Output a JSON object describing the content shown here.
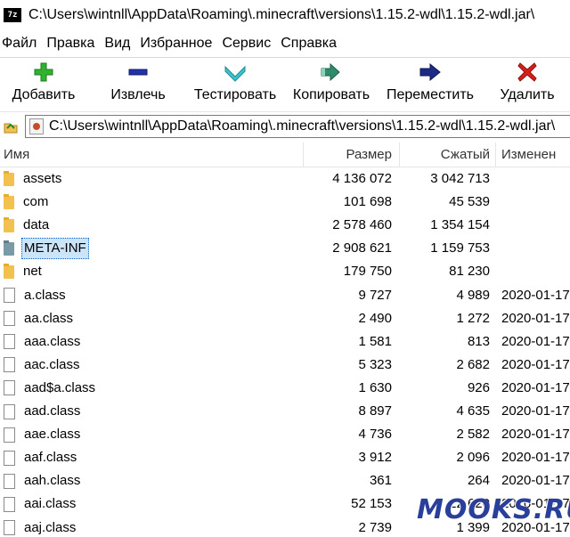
{
  "window": {
    "app_icon_text": "7z",
    "title": "C:\\Users\\wintnll\\AppData\\Roaming\\.minecraft\\versions\\1.15.2-wdl\\1.15.2-wdl.jar\\"
  },
  "menu": [
    "Файл",
    "Правка",
    "Вид",
    "Избранное",
    "Сервис",
    "Справка"
  ],
  "toolbar": {
    "add": {
      "label": "Добавить",
      "icon": "plus-icon",
      "color": "#2fb32f"
    },
    "extract": {
      "label": "Извлечь",
      "icon": "minus-icon",
      "color": "#2231a8"
    },
    "test": {
      "label": "Тестировать",
      "icon": "check-icon",
      "color": "#3bc6cf"
    },
    "copy": {
      "label": "Копировать",
      "icon": "double-arrow-icon",
      "color": "#2e8b6b"
    },
    "move": {
      "label": "Переместить",
      "icon": "arrow-right-icon",
      "color": "#1c2c86"
    },
    "delete": {
      "label": "Удалить",
      "icon": "x-icon",
      "color": "#d6201a"
    }
  },
  "address": {
    "path": "C:\\Users\\wintnll\\AppData\\Roaming\\.minecraft\\versions\\1.15.2-wdl\\1.15.2-wdl.jar\\"
  },
  "columns": {
    "name": "Имя",
    "size": "Размер",
    "packed": "Сжатый",
    "modified": "Изменен"
  },
  "rows": [
    {
      "name": "assets",
      "type": "folder",
      "size": "4 136 072",
      "packed": "3 042 713",
      "modified": ""
    },
    {
      "name": "com",
      "type": "folder",
      "size": "101 698",
      "packed": "45 539",
      "modified": ""
    },
    {
      "name": "data",
      "type": "folder",
      "size": "2 578 460",
      "packed": "1 354 154",
      "modified": ""
    },
    {
      "name": "META-INF",
      "type": "folder-selected",
      "size": "2 908 621",
      "packed": "1 159 753",
      "modified": ""
    },
    {
      "name": "net",
      "type": "folder",
      "size": "179 750",
      "packed": "81 230",
      "modified": ""
    },
    {
      "name": "a.class",
      "type": "file",
      "size": "9 727",
      "packed": "4 989",
      "modified": "2020-01-17"
    },
    {
      "name": "aa.class",
      "type": "file",
      "size": "2 490",
      "packed": "1 272",
      "modified": "2020-01-17"
    },
    {
      "name": "aaa.class",
      "type": "file",
      "size": "1 581",
      "packed": "813",
      "modified": "2020-01-17"
    },
    {
      "name": "aac.class",
      "type": "file",
      "size": "5 323",
      "packed": "2 682",
      "modified": "2020-01-17"
    },
    {
      "name": "aad$a.class",
      "type": "file",
      "size": "1 630",
      "packed": "926",
      "modified": "2020-01-17"
    },
    {
      "name": "aad.class",
      "type": "file",
      "size": "8 897",
      "packed": "4 635",
      "modified": "2020-01-17"
    },
    {
      "name": "aae.class",
      "type": "file",
      "size": "4 736",
      "packed": "2 582",
      "modified": "2020-01-17"
    },
    {
      "name": "aaf.class",
      "type": "file",
      "size": "3 912",
      "packed": "2 096",
      "modified": "2020-01-17"
    },
    {
      "name": "aah.class",
      "type": "file",
      "size": "361",
      "packed": "264",
      "modified": "2020-01-17"
    },
    {
      "name": "aai.class",
      "type": "file",
      "size": "52 153",
      "packed": "22 620",
      "modified": "2020-01-17"
    },
    {
      "name": "aaj.class",
      "type": "file",
      "size": "2 739",
      "packed": "1 399",
      "modified": "2020-01-17"
    }
  ],
  "watermark": "MOOKS.RU"
}
